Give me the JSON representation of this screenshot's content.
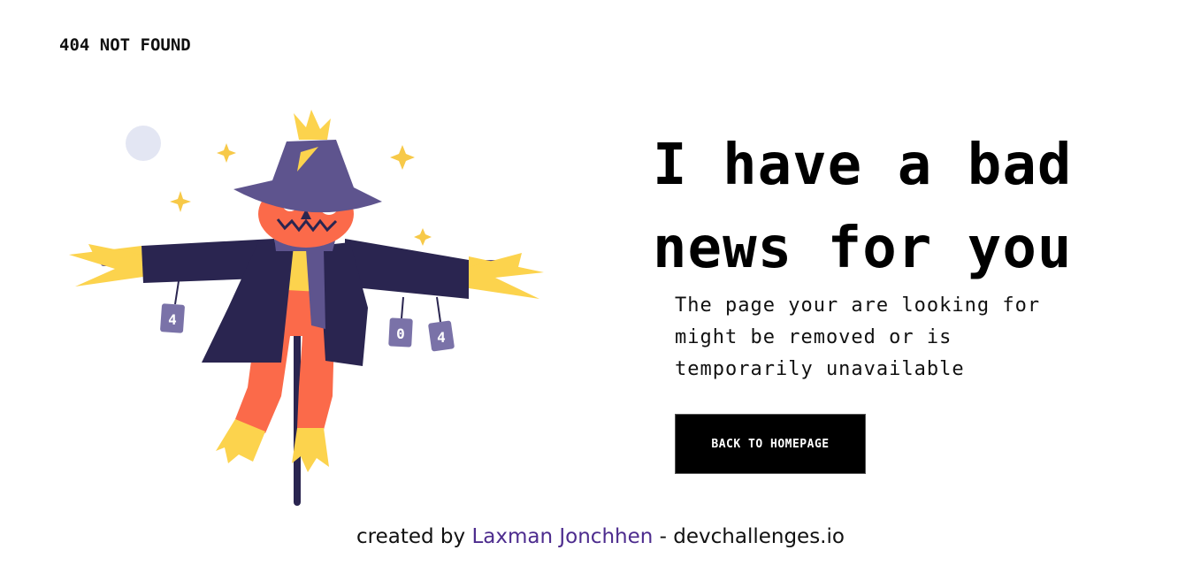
{
  "header": {
    "brand": "404 NOT FOUND"
  },
  "illustration": {
    "name": "scarecrow",
    "cans": [
      "4",
      "0",
      "4"
    ]
  },
  "main": {
    "headline_line1": "I have a bad",
    "headline_line2": "news for you",
    "message_line1": "The page your are looking for",
    "message_line2": "might be removed or is",
    "message_line3": "temporarily unavailable",
    "button_label": "BACK TO HOMEPAGE"
  },
  "footer": {
    "prefix": "created by ",
    "author": "Laxman Jonchhen",
    "separator": " - ",
    "site": "devchallenges.io"
  },
  "colors": {
    "background": "#ffffff",
    "text": "#000000",
    "button_bg": "#000000",
    "button_text": "#ffffff",
    "author_link": "#4d2c8e",
    "scarecrow_hat": "#5e548e",
    "scarecrow_coat": "#2a2550",
    "scarecrow_face": "#fb6a4a",
    "straw": "#fcd34d"
  }
}
